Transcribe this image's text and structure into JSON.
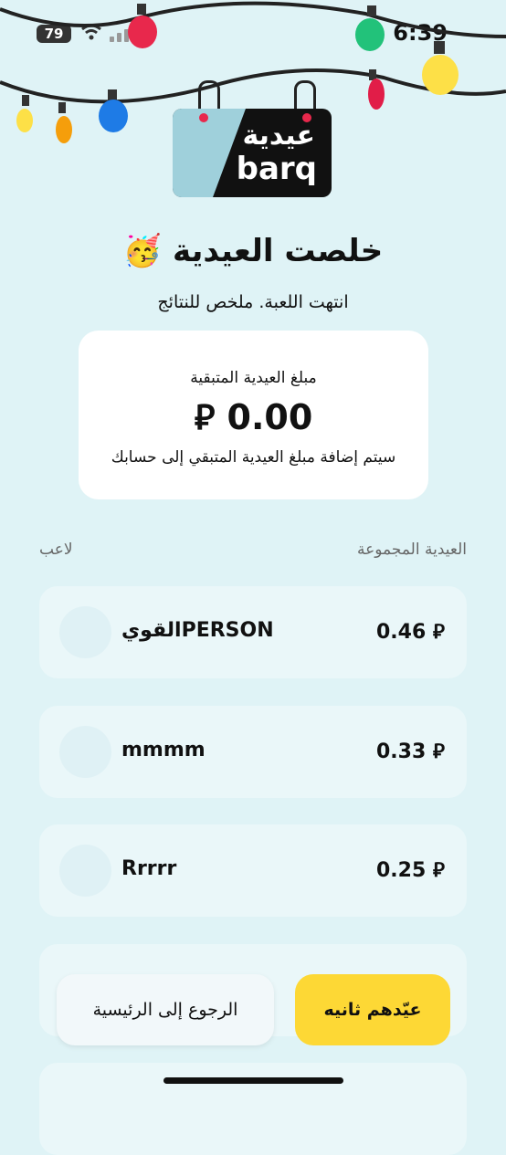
{
  "status_bar": {
    "time": "6:39",
    "battery": "79"
  },
  "logo": {
    "arabic": "عيدية",
    "english": "barq"
  },
  "header": {
    "title": "خلصت العيدية 🥳",
    "subtitle": "انتهت اللعبة. ملخص للنتائج"
  },
  "summary_card": {
    "label": "مبلغ العيدية المتبقية",
    "amount": "0.00 ⃁",
    "note": "سيتم إضافة مبلغ العيدية المتبقي إلى حسابك"
  },
  "table_headers": {
    "player": "لاعب",
    "collected": "العيدية المجموعة"
  },
  "players": [
    {
      "name": "القويPERSON",
      "amount": "0.46 ⃁"
    },
    {
      "name": "mmmm",
      "amount": "0.33 ⃁"
    },
    {
      "name": "Rrrrr",
      "amount": "0.25 ⃁"
    }
  ],
  "buttons": {
    "home": "الرجوع إلى الرئيسية",
    "again": "عيّدهم ثانيه"
  },
  "colors": {
    "background": "#dff3f6",
    "accent": "#fdd835",
    "card": "#ffffff",
    "row": "#eaf7f9"
  }
}
